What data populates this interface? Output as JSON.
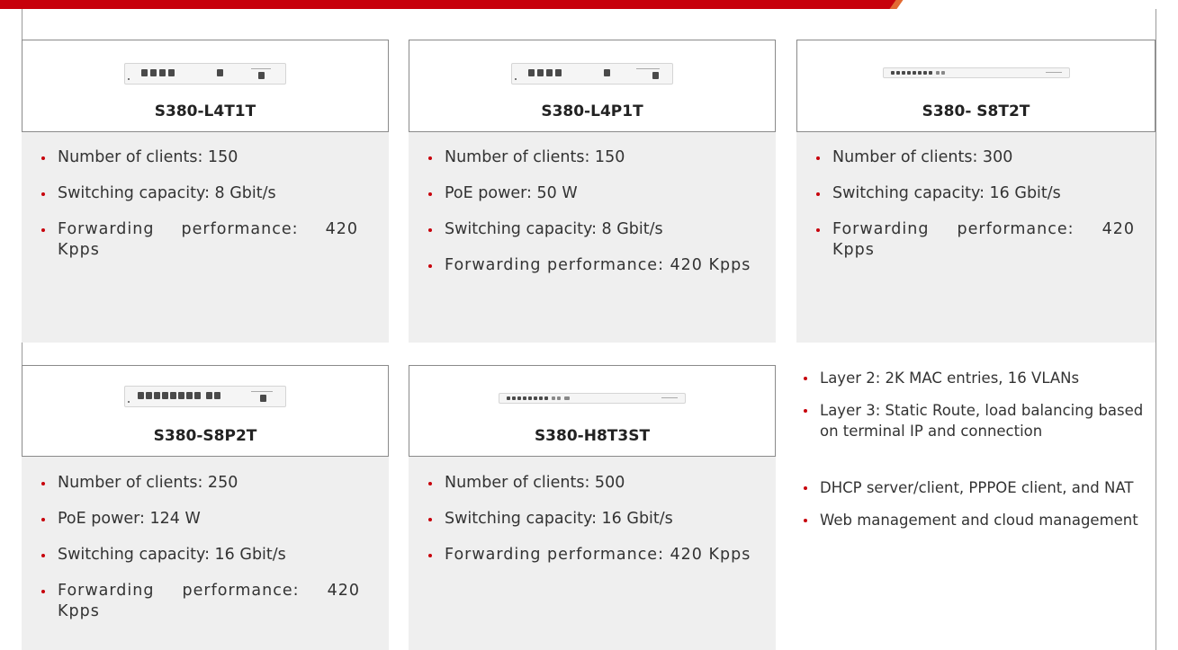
{
  "colors": {
    "brand_red": "#c7000b",
    "accent_orange": "#e26a32",
    "card_bg": "#efefef"
  },
  "products": [
    {
      "model": "S380-L4T1T",
      "icon": "switch-device-image",
      "specs": [
        "Number of clients: 150",
        "Switching capacity: 8 Gbit/s",
        "Forwarding performance: 420 Kpps"
      ]
    },
    {
      "model": "S380-L4P1T",
      "icon": "switch-device-image",
      "specs": [
        "Number of clients: 150",
        "PoE power: 50 W",
        "Switching capacity: 8 Gbit/s",
        "Forwarding performance: 420 Kpps"
      ]
    },
    {
      "model": "S380- S8T2T",
      "icon": "switch-device-image",
      "specs": [
        "Number of clients: 300",
        "Switching capacity: 16 Gbit/s",
        "Forwarding performance: 420 Kpps"
      ]
    },
    {
      "model": "S380-S8P2T",
      "icon": "switch-device-image",
      "specs": [
        "Number of clients: 250",
        "PoE power: 124 W",
        "Switching capacity: 16 Gbit/s",
        "Forwarding performance: 420 Kpps"
      ]
    },
    {
      "model": "S380-H8T3ST",
      "icon": "switch-device-image",
      "specs": [
        "Number of clients: 500",
        "Switching capacity: 16 Gbit/s",
        "Forwarding performance: 420 Kpps"
      ]
    }
  ],
  "features": [
    "Layer 2: 2K MAC entries, 16 VLANs",
    "Layer 3: Static Route, load balancing based on terminal IP and connection",
    "DHCP server/client, PPPOE client, and NAT",
    "Web management and cloud management"
  ]
}
